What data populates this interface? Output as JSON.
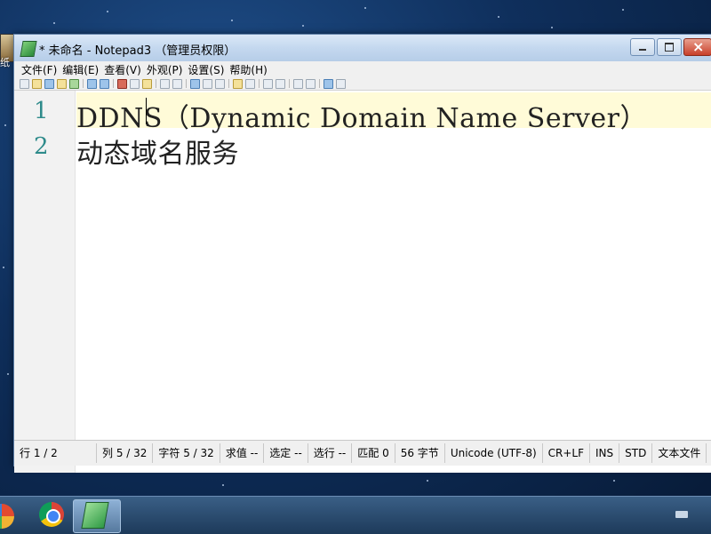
{
  "window": {
    "title": "* 未命名 - Notepad3 （管理员权限）"
  },
  "desktop": {
    "icon_label": "纸"
  },
  "menu": [
    "文件(F)",
    "编辑(E)",
    "查看(V)",
    "外观(P)",
    "设置(S)",
    "帮助(H)"
  ],
  "editor": {
    "lines": [
      {
        "number": "1",
        "text": "DDNS（Dynamic Domain Name Server）"
      },
      {
        "number": "2",
        "text": "动态域名服务"
      }
    ]
  },
  "status": {
    "line": "行 1 / 2",
    "column": "列 5 / 32",
    "char": "字符 5 / 32",
    "value": "求值 --",
    "selected": "选定 --",
    "selected_lines": "选行 --",
    "match": "匹配 0",
    "bytes": "56 字节",
    "encoding": "Unicode (UTF-8)",
    "eol": "CR+LF",
    "ins": "INS",
    "std": "STD",
    "type": "文本文件"
  },
  "taskbar": {
    "apps": [
      "start-icon",
      "chrome-icon",
      "notepad3-icon"
    ]
  }
}
